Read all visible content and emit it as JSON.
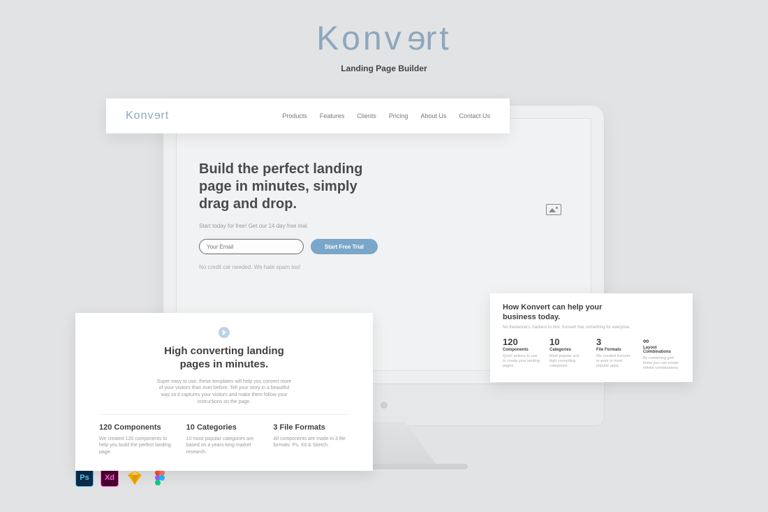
{
  "brand": {
    "logo": "Konvert",
    "subtitle": "Landing Page Builder"
  },
  "nav": {
    "logo": "Konvert",
    "links": [
      "Products",
      "Features",
      "Clients",
      "Pricing",
      "About Us",
      "Contact Us"
    ]
  },
  "hero": {
    "headline": "Build the perfect landing page in minutes, simply drag and drop.",
    "sub": "Start today for free! Get our 14 day free trial.",
    "email_placeholder": "Your Email",
    "cta": "Start Free Trial",
    "note": "No credit car needed. We hate spam too!"
  },
  "feature": {
    "title": "High converting landing pages in minutes.",
    "desc": "Super easy to use, these templates will help you convert more of your visitors than ever before. Tell your story in a beautiful way so it captures your visitors and make them follow your instructions on the page.",
    "cols": [
      {
        "title": "120 Components",
        "desc": "We created 120 components to help you build the perfect landing page."
      },
      {
        "title": "10 Categories",
        "desc": "10 most popular categories are based on a years-long market research."
      },
      {
        "title": "3 File Formats",
        "desc": "All components are made in 3 file formats: Ps, Xd & Sketch."
      }
    ]
  },
  "stats": {
    "title": "How Konvert can help your business today.",
    "sub": "No freelancers, hackers to hire. Konvert has something for everyone.",
    "cols": [
      {
        "big": "120",
        "label": "Components",
        "small": "Quick actions to use to create your landing pages."
      },
      {
        "big": "10",
        "label": "Categories",
        "small": "Most popular and high converting categories."
      },
      {
        "big": "3",
        "label": "File Formats",
        "small": "We created Konvert to work in most popular apps."
      },
      {
        "big": "∞",
        "label": "Layout Combinations",
        "small": "By combining grid items you can create infinite combinations."
      }
    ]
  },
  "apps": {
    "ps": "Ps",
    "xd": "Xd"
  }
}
